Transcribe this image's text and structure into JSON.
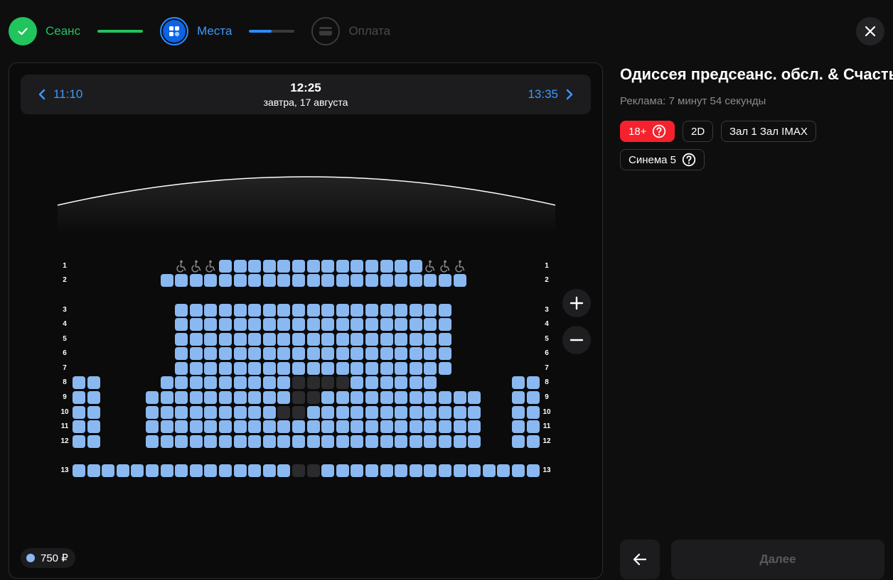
{
  "stepper": {
    "steps": [
      {
        "label": "Сеанс",
        "state": "done"
      },
      {
        "label": "Места",
        "state": "active"
      },
      {
        "label": "Оплата",
        "state": "inactive"
      }
    ],
    "progress": [
      1.0,
      0.5
    ]
  },
  "session_nav": {
    "prev_time": "11:10",
    "current_time": "12:25",
    "current_date": "завтра, 17 августа",
    "next_time": "13:35"
  },
  "hall": {
    "rows": [
      {
        "label": "1",
        "blocks": [
          {
            "start": 7,
            "count": 3,
            "kind": "wheelchair"
          },
          {
            "start": 10,
            "count": 14,
            "kind": "seat"
          },
          {
            "start": 24,
            "count": 3,
            "kind": "wheelchair"
          }
        ]
      },
      {
        "label": "2",
        "blocks": [
          {
            "start": 6,
            "count": 21,
            "kind": "seat"
          }
        ]
      },
      {
        "label": "3",
        "blocks": [
          {
            "start": 7,
            "count": 19,
            "kind": "seat"
          }
        ]
      },
      {
        "label": "4",
        "blocks": [
          {
            "start": 7,
            "count": 19,
            "kind": "seat"
          }
        ]
      },
      {
        "label": "5",
        "blocks": [
          {
            "start": 7,
            "count": 19,
            "kind": "seat"
          }
        ]
      },
      {
        "label": "6",
        "blocks": [
          {
            "start": 7,
            "count": 19,
            "kind": "seat"
          }
        ]
      },
      {
        "label": "7",
        "blocks": [
          {
            "start": 7,
            "count": 19,
            "kind": "seat"
          }
        ]
      },
      {
        "label": "8",
        "blocks": [
          {
            "start": 0,
            "count": 2,
            "kind": "seat"
          },
          {
            "start": 6,
            "count": 19,
            "kind": "seat",
            "occupied": [
              9,
              10,
              11,
              12
            ]
          },
          {
            "start": 30,
            "count": 2,
            "kind": "seat"
          }
        ]
      },
      {
        "label": "9",
        "blocks": [
          {
            "start": 0,
            "count": 2,
            "kind": "seat"
          },
          {
            "start": 5,
            "count": 23,
            "kind": "seat",
            "occupied": [
              10,
              11
            ]
          },
          {
            "start": 30,
            "count": 2,
            "kind": "seat"
          }
        ]
      },
      {
        "label": "10",
        "blocks": [
          {
            "start": 0,
            "count": 2,
            "kind": "seat"
          },
          {
            "start": 5,
            "count": 23,
            "kind": "seat",
            "occupied": [
              9,
              10
            ]
          },
          {
            "start": 30,
            "count": 2,
            "kind": "seat"
          }
        ]
      },
      {
        "label": "11",
        "blocks": [
          {
            "start": 0,
            "count": 2,
            "kind": "seat"
          },
          {
            "start": 5,
            "count": 23,
            "kind": "seat"
          },
          {
            "start": 30,
            "count": 2,
            "kind": "seat"
          }
        ]
      },
      {
        "label": "12",
        "blocks": [
          {
            "start": 0,
            "count": 2,
            "kind": "seat"
          },
          {
            "start": 5,
            "count": 23,
            "kind": "seat"
          },
          {
            "start": 30,
            "count": 2,
            "kind": "seat"
          }
        ]
      },
      {
        "label": "13",
        "blocks": [
          {
            "start": 0,
            "count": 32,
            "kind": "seat",
            "occupied": [
              15,
              16
            ]
          }
        ]
      }
    ]
  },
  "legend": {
    "price": "750 ₽"
  },
  "movie": {
    "title": "Одиссея предсеанс. обсл. & Счастье",
    "ad_info": "Реклама: 7 минут 54 секунды",
    "tags": {
      "age": "18+",
      "format": "2D",
      "hall": "Зал 1 Зал IMAX",
      "cinema": "Синема 5"
    }
  },
  "actions": {
    "next_label": "Далее"
  },
  "colors": {
    "seat_free": "#8ab8f0",
    "seat_taken": "#2b2b2d",
    "done": "#21c45d",
    "active": "#3d99ff",
    "age_badge": "#f5222d"
  },
  "icons": [
    "check-icon",
    "seats-icon",
    "card-icon",
    "close-icon",
    "chevron-left-icon",
    "chevron-right-icon",
    "wheelchair-icon",
    "plus-icon",
    "minus-icon",
    "help-icon",
    "arrow-left-icon"
  ]
}
